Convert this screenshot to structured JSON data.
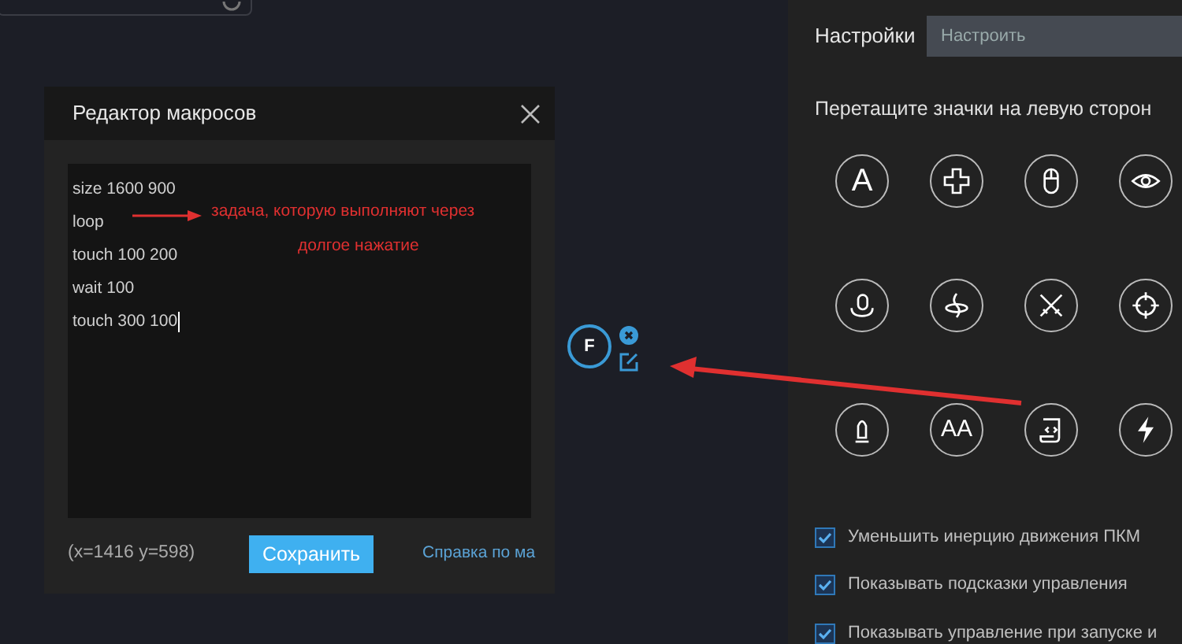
{
  "macro_editor": {
    "title": "Редактор макросов",
    "lines": [
      "size 1600 900",
      "loop",
      "touch 100 200",
      "wait 100",
      "touch 300 100"
    ],
    "coordinates": "(x=1416  y=598)",
    "save_button": "Сохранить",
    "help_link": "Справка по ма"
  },
  "annotation": {
    "lines": [
      "задача, которую выполняют через",
      "долгое нажатие"
    ]
  },
  "placed_key": {
    "label": "F"
  },
  "settings_panel": {
    "label": "Настройки",
    "field": {
      "placeholder": "Настроить"
    },
    "hint": "Перетащите значки на левую сторон",
    "icons": [
      {
        "kind": "text",
        "label": "A"
      },
      {
        "kind": "icon"
      },
      {
        "kind": "icon"
      },
      {
        "kind": "icon"
      },
      {
        "kind": "icon"
      },
      {
        "kind": "icon"
      },
      {
        "kind": "icon"
      },
      {
        "kind": "icon"
      },
      {
        "kind": "icon"
      },
      {
        "kind": "text",
        "label": "AA"
      },
      {
        "kind": "icon"
      },
      {
        "kind": "icon"
      }
    ],
    "options": [
      {
        "label": "Уменьшить инерцию движения ПКМ",
        "checked": true
      },
      {
        "label": "Показывать подсказки управления",
        "checked": true
      },
      {
        "label": "Показывать управление при запуске и",
        "checked": true
      }
    ]
  }
}
